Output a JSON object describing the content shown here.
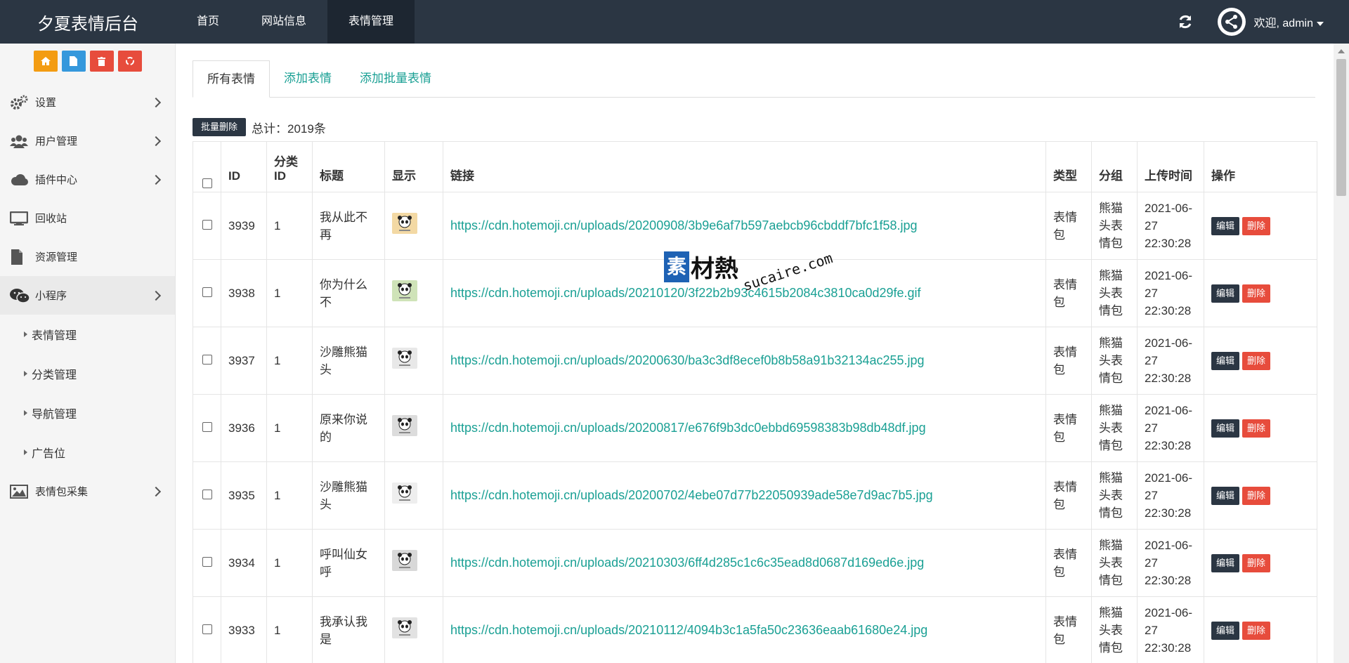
{
  "app": {
    "brand": "夕夏表情后台",
    "top_nav": [
      "首页",
      "网站信息",
      "表情管理"
    ],
    "welcome": "欢迎, admin"
  },
  "sidebar": {
    "menu": [
      {
        "label": "设置",
        "icon": "gears-icon"
      },
      {
        "label": "用户管理",
        "icon": "users-icon"
      },
      {
        "label": "插件中心",
        "icon": "cloud-icon"
      },
      {
        "label": "回收站",
        "icon": "monitor-icon"
      },
      {
        "label": "资源管理",
        "icon": "file-icon"
      },
      {
        "label": "小程序",
        "icon": "wechat-icon"
      }
    ],
    "sub_items": [
      "表情管理",
      "分类管理",
      "导航管理",
      "广告位"
    ],
    "last_item": {
      "label": "表情包采集",
      "icon": "image-icon"
    }
  },
  "main": {
    "tabs": [
      "所有表情",
      "添加表情",
      "添加批量表情"
    ],
    "bulk_delete": "批量删除",
    "total": "总计：2019条",
    "headers": [
      "ID",
      "分类ID",
      "标题",
      "显示",
      "链接",
      "类型",
      "分组",
      "上传时间",
      "操作"
    ],
    "edit_label": "编辑",
    "delete_label": "删除",
    "rows": [
      {
        "id": "3939",
        "cat": "1",
        "title": "我从此不再",
        "link": "https://cdn.hotemoji.cn/uploads/20200908/3b9e6af7b597aebcb96cbddf7bfc1f58.jpg",
        "type": "表情包",
        "group": "熊猫头表情包",
        "time": "2021-06-27 22:30:28"
      },
      {
        "id": "3938",
        "cat": "1",
        "title": "你为什么不",
        "link": "https://cdn.hotemoji.cn/uploads/20210120/3f22b2b93c4615b2084c3810ca0d29fe.gif",
        "type": "表情包",
        "group": "熊猫头表情包",
        "time": "2021-06-27 22:30:28"
      },
      {
        "id": "3937",
        "cat": "1",
        "title": "沙雕熊猫头",
        "link": "https://cdn.hotemoji.cn/uploads/20200630/ba3c3df8ecef0b8b58a91b32134ac255.jpg",
        "type": "表情包",
        "group": "熊猫头表情包",
        "time": "2021-06-27 22:30:28"
      },
      {
        "id": "3936",
        "cat": "1",
        "title": "原来你说的",
        "link": "https://cdn.hotemoji.cn/uploads/20200817/e676f9b3dc0ebbd69598383b98db48df.jpg",
        "type": "表情包",
        "group": "熊猫头表情包",
        "time": "2021-06-27 22:30:28"
      },
      {
        "id": "3935",
        "cat": "1",
        "title": "沙雕熊猫头",
        "link": "https://cdn.hotemoji.cn/uploads/20200702/4ebe07d77b22050939ade58e7d9ac7b5.jpg",
        "type": "表情包",
        "group": "熊猫头表情包",
        "time": "2021-06-27 22:30:28"
      },
      {
        "id": "3934",
        "cat": "1",
        "title": "呼叫仙女呼",
        "link": "https://cdn.hotemoji.cn/uploads/20210303/6ff4d285c1c6c35ead8d0687d169ed6e.jpg",
        "type": "表情包",
        "group": "熊猫头表情包",
        "time": "2021-06-27 22:30:28"
      },
      {
        "id": "3933",
        "cat": "1",
        "title": "我承认我是",
        "link": "https://cdn.hotemoji.cn/uploads/20210112/4094b3c1a5fa50c23636eaab61680e24.jpg",
        "type": "表情包",
        "group": "熊猫头表情包",
        "time": "2021-06-27 22:30:28"
      }
    ]
  },
  "watermark": {
    "box": "素",
    "text": "材熱",
    "domain": "sucaire.com"
  },
  "colors": {
    "topbar": "#2b3643",
    "accent": "#1aa094",
    "danger": "#e74c3c",
    "warning": "#f39c12",
    "info": "#3598dc"
  }
}
